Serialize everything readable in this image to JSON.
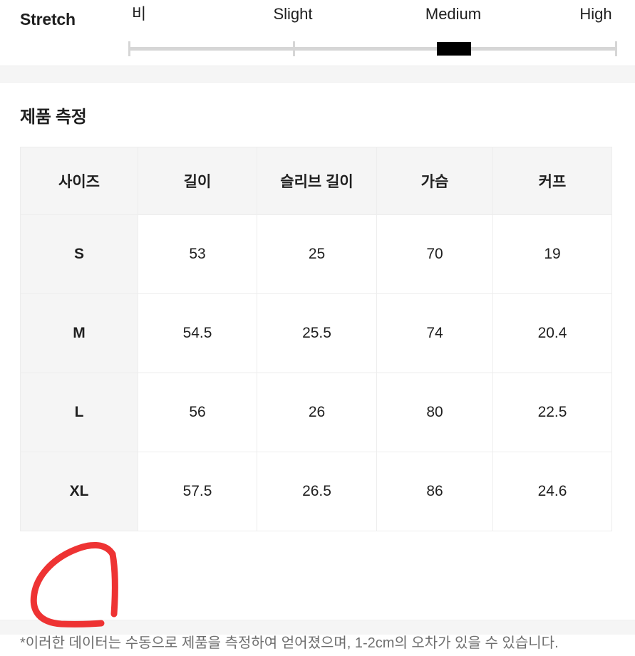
{
  "stretch": {
    "title": "Stretch",
    "labels": [
      "비",
      "Slight",
      "Medium",
      "High"
    ],
    "selected": "Medium",
    "track_color": "#d6d6d6",
    "thumb_color": "#000000"
  },
  "measurement": {
    "title": "제품 측정",
    "columns": [
      "사이즈",
      "길이",
      "슬리브 길이",
      "가슴",
      "커프"
    ],
    "rows": [
      {
        "size": "S",
        "length": "53",
        "sleeve": "25",
        "chest": "70",
        "cuff": "19"
      },
      {
        "size": "M",
        "length": "54.5",
        "sleeve": "25.5",
        "chest": "74",
        "cuff": "20.4"
      },
      {
        "size": "L",
        "length": "56",
        "sleeve": "26",
        "chest": "80",
        "cuff": "22.5"
      },
      {
        "size": "XL",
        "length": "57.5",
        "sleeve": "26.5",
        "chest": "86",
        "cuff": "24.6"
      }
    ],
    "footnote": "*이러한 데이터는 수동으로 제품을 측정하여 얻어졌으며, 1-2cm의 오차가 있을 수 있습니다.",
    "annotation": {
      "target": "XL",
      "color": "#ee3333",
      "shape": "hand-drawn-circle"
    }
  }
}
